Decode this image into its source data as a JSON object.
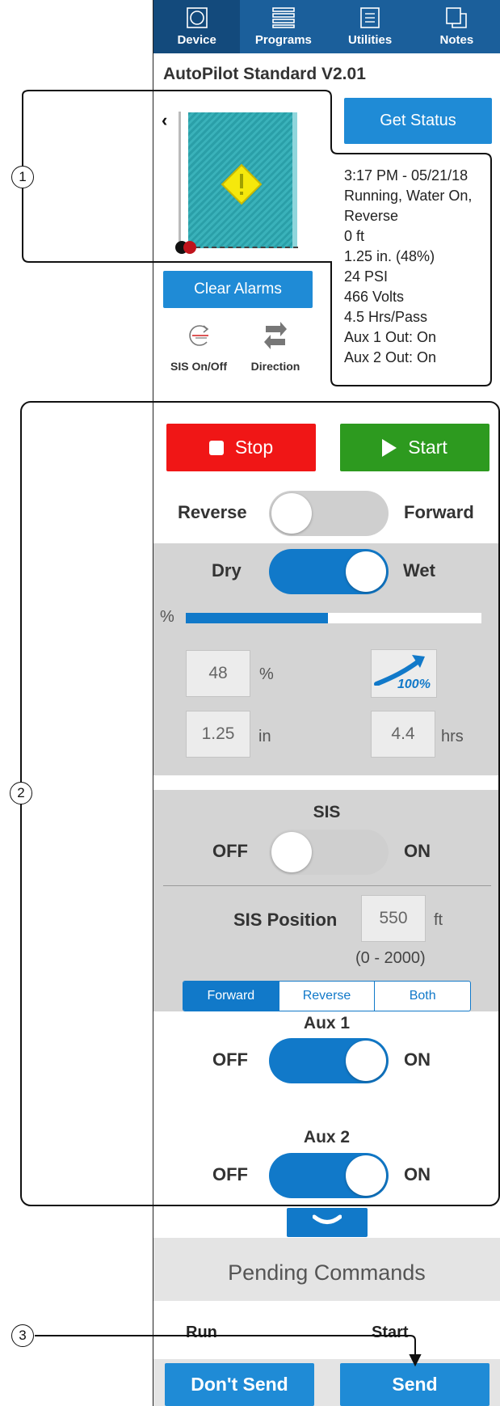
{
  "nav": {
    "items": [
      {
        "label": "Device",
        "icon": "device-icon"
      },
      {
        "label": "Programs",
        "icon": "programs-icon"
      },
      {
        "label": "Utilities",
        "icon": "utilities-icon"
      },
      {
        "label": "Notes",
        "icon": "notes-icon"
      }
    ]
  },
  "header": {
    "title": "AutoPilot Standard V2.01"
  },
  "status": {
    "button": "Get Status",
    "lines": [
      "3:17 PM - 05/21/18",
      "Running, Water On,",
      "Reverse",
      "0 ft",
      "1.25 in. (48%)",
      "24  PSI",
      "466 Volts",
      "4.5 Hrs/Pass",
      "Aux 1 Out: On",
      "Aux 2 Out: On"
    ]
  },
  "alarms": {
    "clear_label": "Clear Alarms"
  },
  "controls": {
    "sis_label": "SIS On/Off",
    "direction_label": "Direction"
  },
  "run": {
    "stop_label": "Stop",
    "start_label": "Start"
  },
  "direction_toggle": {
    "left": "Reverse",
    "right": "Forward",
    "on": false
  },
  "water_toggle": {
    "left": "Dry",
    "right": "Wet",
    "on": true
  },
  "application": {
    "percent_sign": "%",
    "progress": 0.48,
    "percent_value": "48",
    "percent_unit": "%",
    "depth_value": "1.25",
    "depth_unit": "in",
    "hours_value": "4.4",
    "hours_unit": "hrs",
    "boost_label": "100%"
  },
  "sis": {
    "title": "SIS",
    "off": "OFF",
    "on": "ON",
    "enabled": false,
    "position_label": "SIS Position",
    "position_value": "550",
    "position_unit": "ft",
    "range": "(0 - 2000)",
    "segments": [
      "Forward",
      "Reverse",
      "Both"
    ],
    "selected_segment": "Forward"
  },
  "aux1": {
    "title": "Aux 1",
    "off": "OFF",
    "on": "ON",
    "enabled": true
  },
  "aux2": {
    "title": "Aux 2",
    "off": "OFF",
    "on": "ON",
    "enabled": true
  },
  "pending": {
    "title": "Pending Commands",
    "rows": [
      {
        "command": "Run",
        "value": "Start"
      }
    ],
    "dont_send_label": "Don't Send",
    "send_label": "Send"
  },
  "callouts": [
    "1",
    "2",
    "3"
  ],
  "colors": {
    "nav_blue": "#1b5f9b",
    "button_blue": "#1f8bd6",
    "toggle_blue": "#1179c9",
    "stop_red": "#f01616",
    "start_green": "#2d9a1f"
  }
}
